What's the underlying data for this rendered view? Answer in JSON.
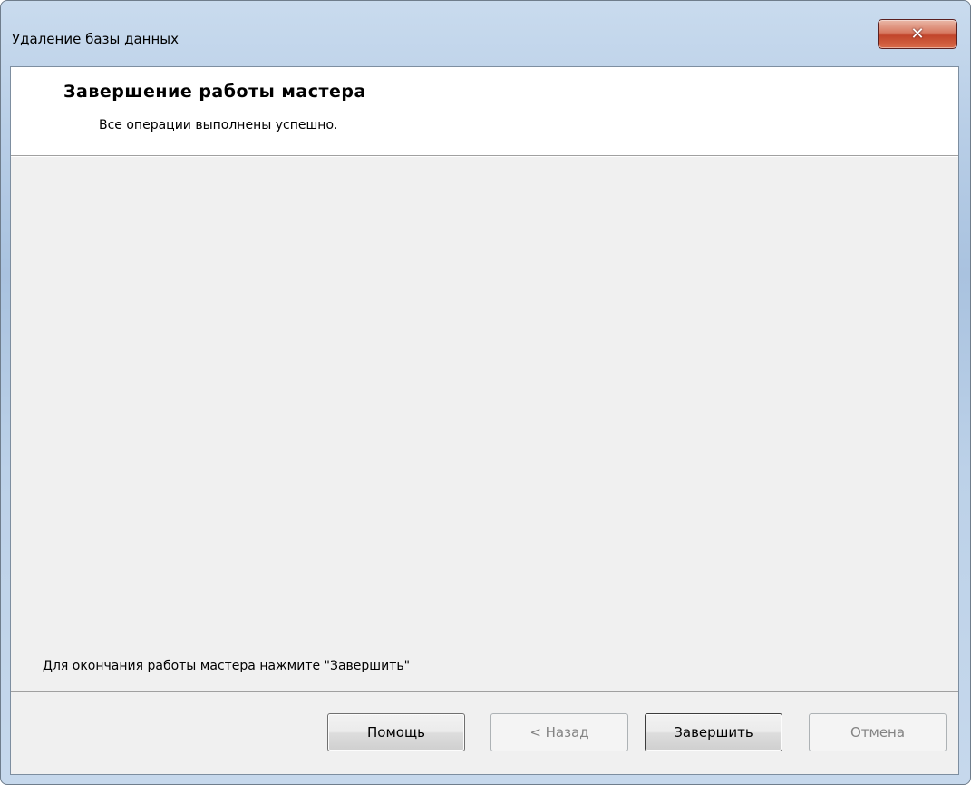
{
  "window": {
    "title": "Удаление базы данных",
    "close_symbol": "✕"
  },
  "header": {
    "title": "Завершение работы мастера",
    "subtitle": "Все операции выполнены успешно."
  },
  "body": {
    "footer_text": "Для окончания работы мастера нажмите \"Завершить\""
  },
  "buttons": {
    "help": "Помощь",
    "back": "< Назад",
    "finish": "Завершить",
    "cancel": "Отмена"
  }
}
